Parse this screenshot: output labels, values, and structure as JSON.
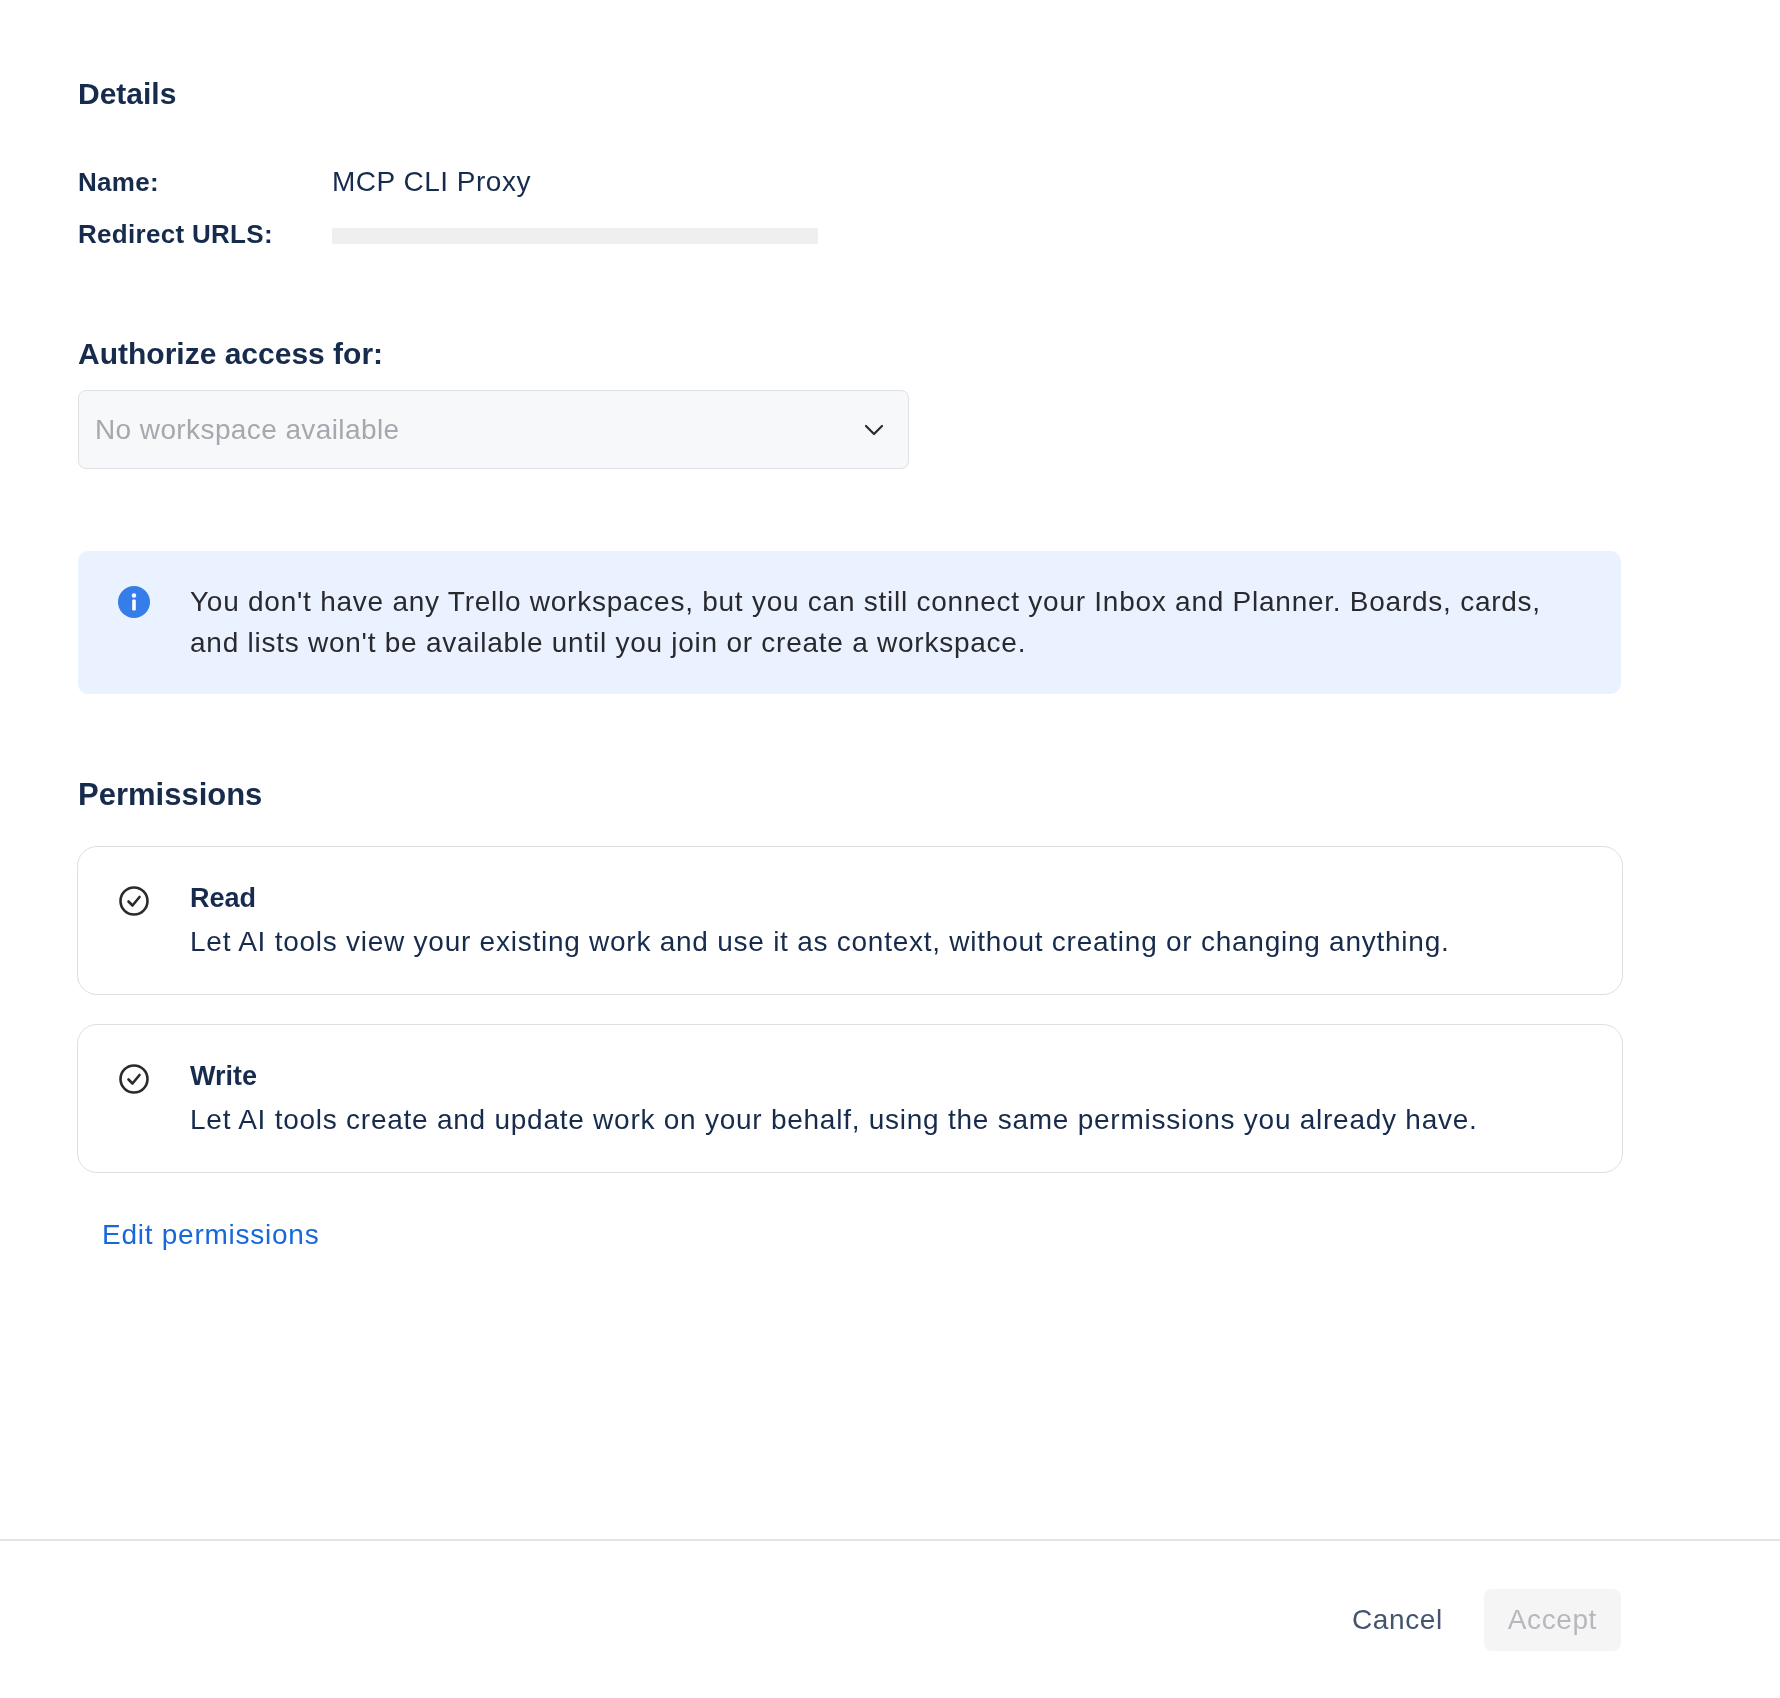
{
  "details": {
    "title": "Details",
    "rows": [
      {
        "label": "Name:",
        "kind": "text",
        "value": "MCP CLI Proxy"
      },
      {
        "label": "Redirect URLS:",
        "kind": "redacted"
      }
    ]
  },
  "workspace": {
    "label": "Authorize access for:",
    "dropdown": {
      "placeholder": "No workspace available",
      "disabled": true
    }
  },
  "notice": {
    "text": "You don't have any Trello workspaces, but you can still connect your Inbox and Planner. Boards, cards, and lists won't be available until you join or create a workspace."
  },
  "permissions": {
    "title": "Permissions",
    "items": [
      {
        "title": "Read",
        "description": "Let AI tools view your existing work and use it as context, without creating or changing anything."
      },
      {
        "title": "Write",
        "description": "Let AI tools create and update work on your behalf, using the same permissions you already have."
      }
    ],
    "edit_link": "Edit permissions"
  },
  "footer": {
    "buttons": [
      {
        "label": "Cancel",
        "kind": "subtle",
        "disabled": false
      },
      {
        "label": "Accept",
        "kind": "primary",
        "disabled": true
      }
    ]
  }
}
